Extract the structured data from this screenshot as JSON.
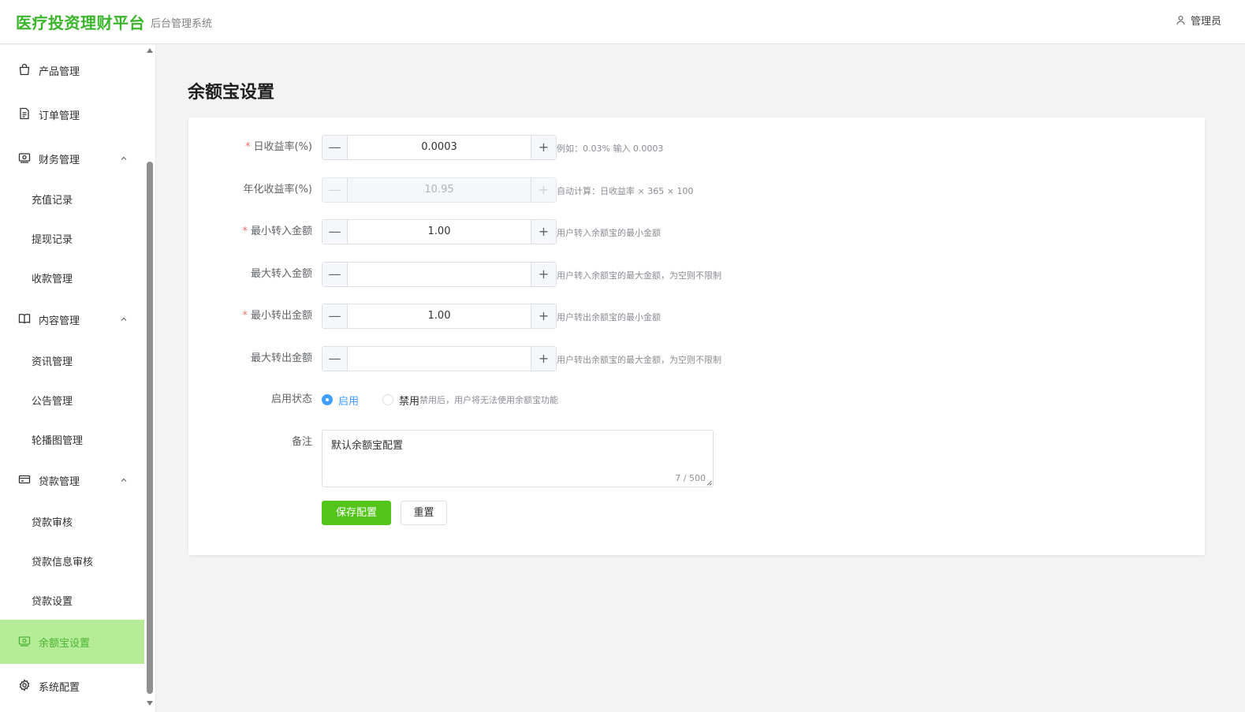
{
  "header": {
    "brand": "医疗投资理财平台",
    "subtitle": "后台管理系统",
    "user": "管理员",
    "brand_color": "#3bb52c"
  },
  "sidebar": {
    "active_bg": "#b6eb97",
    "active_color": "#49b535",
    "items": [
      {
        "label": "产品管理",
        "icon": "shopping-bag-icon"
      },
      {
        "label": "订单管理",
        "icon": "document-icon"
      },
      {
        "label": "财务管理",
        "icon": "wallet-icon"
      },
      {
        "label": "充值记录"
      },
      {
        "label": "提现记录"
      },
      {
        "label": "收款管理"
      },
      {
        "label": "内容管理",
        "icon": "book-icon"
      },
      {
        "label": "资讯管理"
      },
      {
        "label": "公告管理"
      },
      {
        "label": "轮播图管理"
      },
      {
        "label": "贷款管理",
        "icon": "credit-card-icon"
      },
      {
        "label": "贷款审核"
      },
      {
        "label": "贷款信息审核"
      },
      {
        "label": "贷款设置"
      },
      {
        "label": "余额宝设置",
        "icon": "wallet-icon"
      },
      {
        "label": "系统配置",
        "icon": "gear-icon"
      }
    ]
  },
  "main": {
    "title": "余额宝设置",
    "form": {
      "daily_rate": {
        "label": "日收益率(%)",
        "value": "0.0003",
        "hint": "例如：0.03% 输入 0.0003"
      },
      "annual_rate": {
        "label": "年化收益率(%)",
        "value": "10.95",
        "hint": "自动计算：日收益率 × 365 × 100"
      },
      "min_in": {
        "label": "最小转入金额",
        "value": "1.00",
        "hint": "用户转入余额宝的最小金额"
      },
      "max_in": {
        "label": "最大转入金额",
        "value": "",
        "hint": "用户转入余额宝的最大金额，为空则不限制"
      },
      "min_out": {
        "label": "最小转出金额",
        "value": "1.00",
        "hint": "用户转出余额宝的最小金额"
      },
      "max_out": {
        "label": "最大转出金额",
        "value": "",
        "hint": "用户转出余额宝的最大金额，为空则不限制"
      },
      "status": {
        "label": "启用状态",
        "options": [
          "启用",
          "禁用"
        ],
        "selected": "启用",
        "hint": "禁用后，用户将无法使用余额宝功能"
      },
      "remark": {
        "label": "备注",
        "value": "默认余额宝配置",
        "count": "7 / 500"
      }
    },
    "buttons": {
      "save": "保存配置",
      "reset": "重置"
    },
    "minus_glyph": "—",
    "plus_glyph": "+"
  }
}
